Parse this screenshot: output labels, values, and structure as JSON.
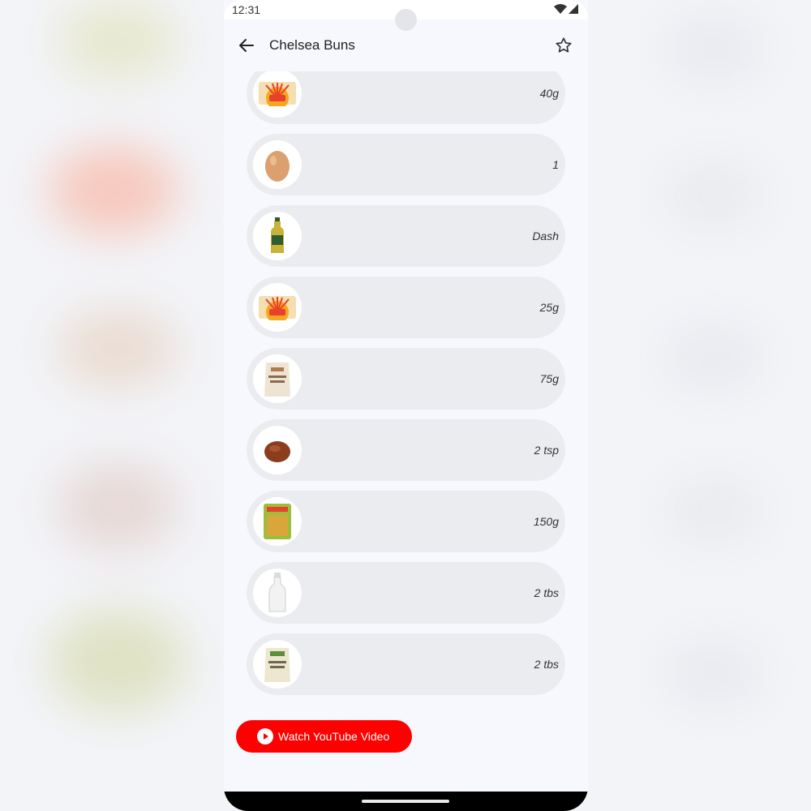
{
  "status_bar": {
    "time": "12:31"
  },
  "app_bar": {
    "title": "Chelsea Buns",
    "back_icon": "arrow-back-icon",
    "favorite_icon": "star-outline-icon"
  },
  "ingredients": [
    {
      "icon": "butter-icon",
      "quantity": "40g"
    },
    {
      "icon": "egg-icon",
      "quantity": "1"
    },
    {
      "icon": "oil-bottle-icon",
      "quantity": "Dash"
    },
    {
      "icon": "butter-icon",
      "quantity": "25g"
    },
    {
      "icon": "brown-sugar-bag-icon",
      "quantity": "75g"
    },
    {
      "icon": "spice-powder-icon",
      "quantity": "2 tsp"
    },
    {
      "icon": "dried-fruit-pack-icon",
      "quantity": "150g"
    },
    {
      "icon": "milk-bottle-icon",
      "quantity": "2 tbs"
    },
    {
      "icon": "caster-sugar-bag-icon",
      "quantity": "2 tbs"
    }
  ],
  "youtube_button": {
    "label": "Watch YouTube Video",
    "icon": "play-circle-icon",
    "color": "#ff0000"
  },
  "colors": {
    "row_background": "#ebecf0",
    "screen_background": "#f7f8fd"
  }
}
